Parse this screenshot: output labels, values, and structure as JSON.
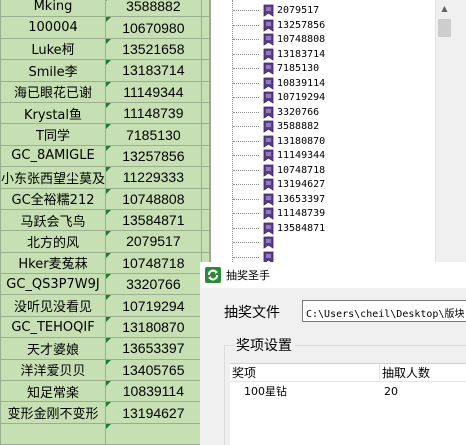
{
  "sheet": {
    "rows": [
      [
        "Mking",
        "3588882"
      ],
      [
        "100004",
        "10670980"
      ],
      [
        "Luke柯",
        "13521658"
      ],
      [
        "Smile李",
        "13183714"
      ],
      [
        "海已眼花已谢",
        "11149344"
      ],
      [
        "Krystal鱼",
        "11148739"
      ],
      [
        "T同学",
        "7185130"
      ],
      [
        "GC_8AMIGLE",
        "13257856"
      ],
      [
        "小东张西望尘莫及",
        "11229333"
      ],
      [
        "GC全裕糯212",
        "10748808"
      ],
      [
        "马跃会飞鸟",
        "13584871"
      ],
      [
        "北方的风",
        "2079517"
      ],
      [
        "Hker麦菟菻",
        "10748718"
      ],
      [
        "GC_QS3P7W9J",
        "3320766"
      ],
      [
        "没听见没看见",
        "10719294"
      ],
      [
        "GC_TEHOQIF",
        "13180870"
      ],
      [
        "天才婆娘",
        "13653397"
      ],
      [
        "洋洋爱贝贝",
        "13405765"
      ],
      [
        "知足常楽",
        "10839114"
      ],
      [
        "变形金刚不变形",
        "13194627"
      ],
      [
        "",
        ""
      ]
    ]
  },
  "tree": {
    "items": [
      "2079517",
      "13257856",
      "10748808",
      "13183714",
      "7185130",
      "10839114",
      "10719294",
      "3320766",
      "3588882",
      "13180870",
      "11149344",
      "10748718",
      "13194627",
      "13653397",
      "11148739",
      "13584871",
      "",
      ""
    ],
    "icon": "bookmark-node-icon"
  },
  "dialog": {
    "title": "抽奖圣手",
    "title_icon": "app-refresh-icon",
    "file_label": "抽奖文件",
    "file_path": "C:\\Users\\cheil\\Desktop\\版块",
    "group_title": "奖项设置",
    "grid": {
      "headers": [
        "奖项",
        "抽取人数"
      ],
      "rows": [
        [
          "100星钻",
          "20"
        ]
      ]
    }
  },
  "colors": {
    "sheet_bg": "#c6e0b4",
    "sheet_marker": "#1e7b34",
    "dialog_bg": "#f0f0f0"
  }
}
